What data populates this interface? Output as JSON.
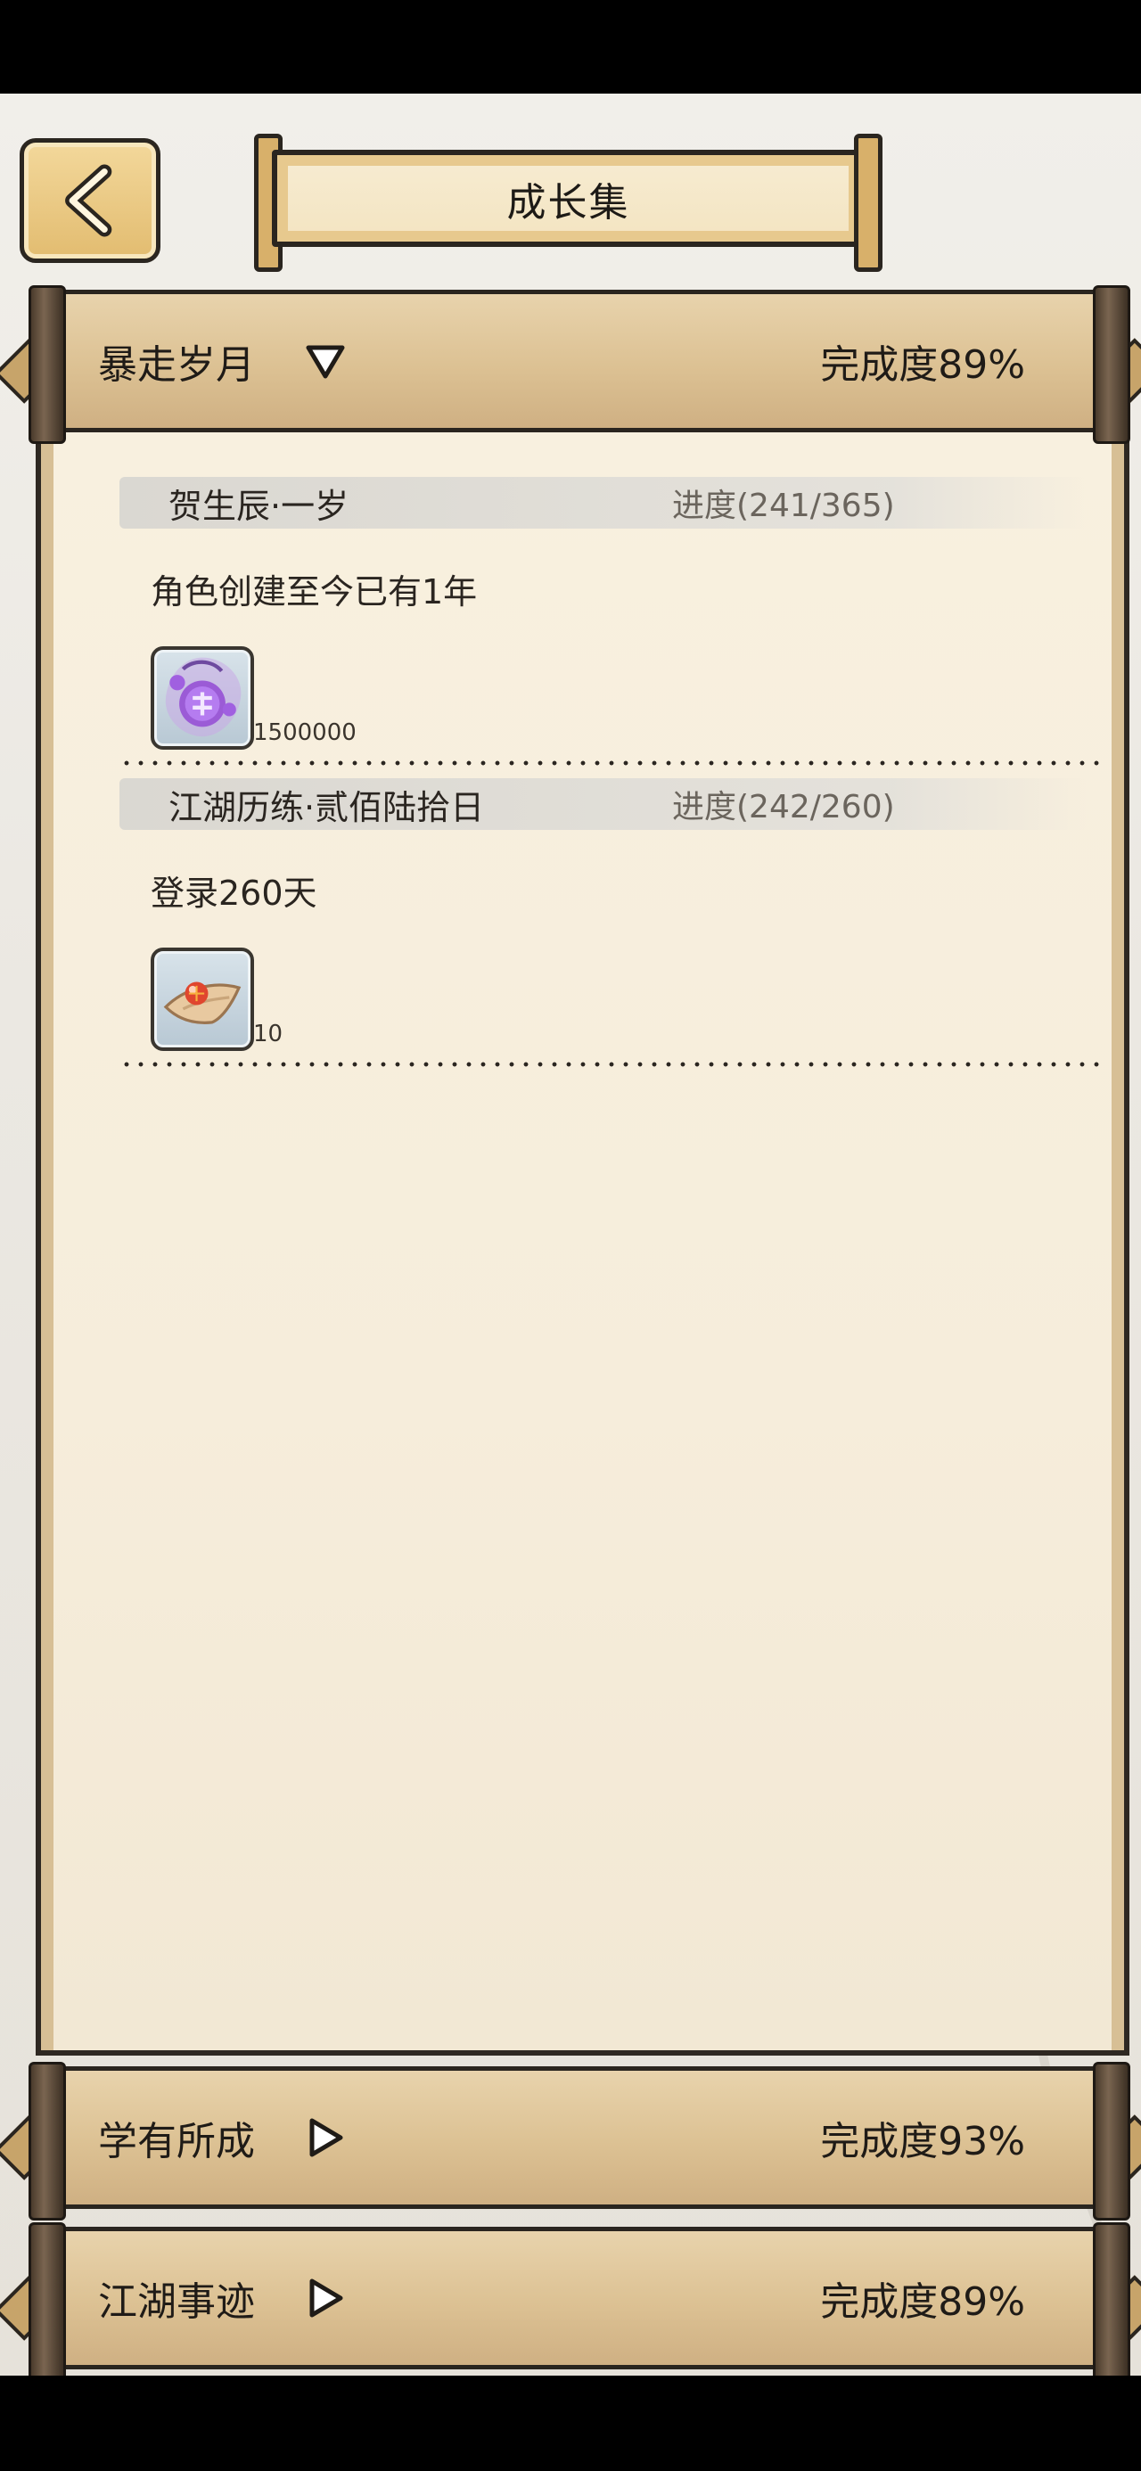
{
  "header": {
    "back_icon": "chevron-left-icon",
    "title": "成长集"
  },
  "sections": [
    {
      "label": "暴走岁月",
      "completion": "完成度89%",
      "expanded": true,
      "tasks": [
        {
          "name": "贺生辰·一岁",
          "progress": "进度(241/365)",
          "description": "角色创建至今已有1年",
          "reward_icon": "purple-orb-token-icon",
          "reward_qty": "1500000"
        },
        {
          "name": "江湖历练·贰佰陆拾日",
          "progress": "进度(242/260)",
          "description": "登录260天",
          "reward_icon": "red-pill-on-cloth-icon",
          "reward_qty": "10"
        }
      ]
    },
    {
      "label": "学有所成",
      "completion": "完成度93%",
      "expanded": false
    },
    {
      "label": "江湖事迹",
      "completion": "完成度89%",
      "expanded": false
    }
  ],
  "colors": {
    "bar": "#dcc193",
    "paper": "#f6eddb",
    "ink": "#2a251f",
    "back_button": "#e9c77f"
  }
}
